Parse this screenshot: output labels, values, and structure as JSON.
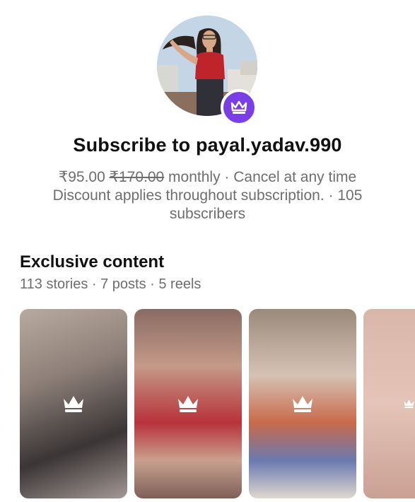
{
  "profile": {
    "avatar_icon": "profile-photo",
    "badge_icon": "crown-icon",
    "badge_color": "#7a3ee6"
  },
  "subscribe": {
    "title": "Subscribe to payal.yadav.990",
    "price": "₹95.00",
    "original_price": "₹170.00",
    "terms": "monthly · Cancel at any time",
    "discount_note": "Discount applies throughout subscription. · 105 subscribers"
  },
  "exclusive": {
    "heading": "Exclusive content",
    "counts": "113 stories · 7 posts · 5 reels"
  },
  "content_cards": [
    {
      "icon": "crown-icon",
      "locked": true
    },
    {
      "icon": "crown-icon",
      "locked": true
    },
    {
      "icon": "crown-icon",
      "locked": true
    },
    {
      "icon": "crown-icon",
      "locked": true
    }
  ]
}
